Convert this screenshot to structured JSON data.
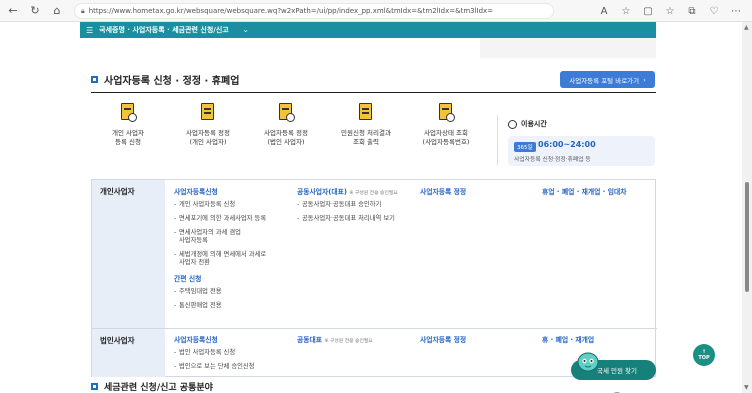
{
  "browser": {
    "url": "https://www.hometax.go.kr/websquare/websquare.wq?w2xPath=/ui/pp/index_pp.xml&tmIdx=&tm2lIdx=&tm3lIdx="
  },
  "menu_bar": {
    "breadcrumb": "국세증명 · 사업자등록 · 세금관련 신청/신고"
  },
  "section": {
    "title": "사업자등록 신청 · 정정 · 휴폐업",
    "portal_button": "사업자등록 포털 바로가기"
  },
  "shortcuts": [
    {
      "label": "개인 사업자\n등록 신청",
      "icon": "document-user-icon"
    },
    {
      "label": "사업자등록 정정\n(개인 사업자)",
      "icon": "building-document-icon"
    },
    {
      "label": "사업자등록 정정\n(법인 사업자)",
      "icon": "document-edit-icon"
    },
    {
      "label": "민원신청 처리결과\n조회 출력",
      "icon": "document-check-icon"
    },
    {
      "label": "사업자상태 조회\n(사업자등록번호)",
      "icon": "document-search-icon"
    }
  ],
  "hours": {
    "title": "이용시간",
    "badge": "365일",
    "time": "06:00~24:00",
    "desc": "사업자등록 신청·정정·휴폐업 등"
  },
  "table": {
    "individual": {
      "header": "개인사업자",
      "col1_title": "사업자등록신청",
      "col1_items": [
        "개인 사업자등록 신청",
        "면세포기에 의한 과세사업자 등록",
        "면세사업자의 과세 겸업\n사업자등록",
        "세법개정에 의해 면세에서 과세로\n사업자 전환"
      ],
      "col1_sub": "간편 신청",
      "col1_sub_items": [
        "주택임대업 전용",
        "통신판매업 전용"
      ],
      "col2_title": "공동사업자(대표)",
      "col2_note": "※ 구성원 전용 승인필요",
      "col2_items": [
        "공동사업자·공동대표 승인하기",
        "공동사업자·공동대표 처리내역 보기"
      ],
      "col3_title": "사업자등록 정정",
      "col4_title": "휴업 · 폐업 · 재개업 · 임대차"
    },
    "corporate": {
      "header": "법인사업자",
      "col1_title": "사업자등록신청",
      "col1_items": [
        "법인 사업자등록 신청",
        "법인으로 보는 단체 승인신청"
      ],
      "col2_title": "공동대표",
      "col2_note": "※ 구성원 전용 승인필요",
      "col3_title": "사업자등록 정정",
      "col4_title": "휴 · 폐업 · 재개업"
    }
  },
  "second_section": {
    "title": "세금관련 신청/신고 공통분야"
  },
  "floating": {
    "top": "TOP",
    "civil": "국세 민원 찾기"
  }
}
